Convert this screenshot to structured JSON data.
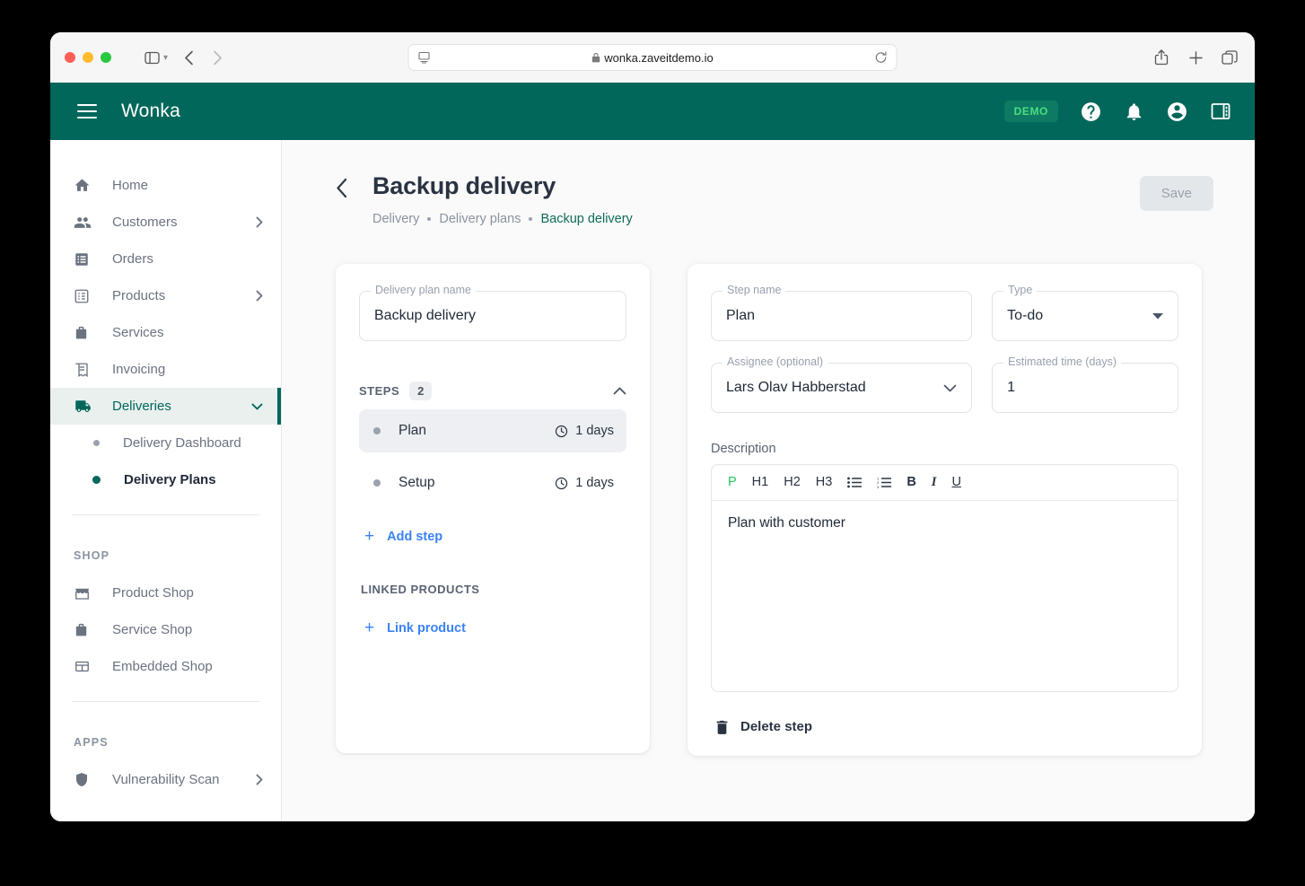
{
  "browser": {
    "url": "wonka.zaveitdemo.io",
    "icons": {
      "sidebar_toggle": "sidebar-toggle-icon",
      "back": "back-arrow-icon",
      "forward": "forward-arrow-icon",
      "reader": "reader-view-icon",
      "lock": "lock-icon",
      "reload": "reload-icon",
      "share": "share-icon",
      "new_tab": "plus-icon",
      "tabs": "tabs-overview-icon"
    }
  },
  "appbar": {
    "brand": "Wonka",
    "demo_badge": "DEMO",
    "menu_icon": "hamburger-menu-icon",
    "help_icon": "help-circle-icon",
    "bell_icon": "notification-bell-icon",
    "account_icon": "account-circle-icon",
    "panel_icon": "right-panel-icon",
    "bg_color": "#00675a",
    "badge_text_color": "#4ade80"
  },
  "sidebar": {
    "items": [
      {
        "label": "Home",
        "icon": "home-icon",
        "expandable": false,
        "active": false
      },
      {
        "label": "Customers",
        "icon": "people-icon",
        "expandable": true,
        "active": false
      },
      {
        "label": "Orders",
        "icon": "orders-icon",
        "expandable": false,
        "active": false
      },
      {
        "label": "Products",
        "icon": "products-grid-icon",
        "expandable": true,
        "active": false
      },
      {
        "label": "Services",
        "icon": "services-bag-icon",
        "expandable": false,
        "active": false
      },
      {
        "label": "Invoicing",
        "icon": "invoice-icon",
        "expandable": false,
        "active": false
      },
      {
        "label": "Deliveries",
        "icon": "truck-icon",
        "expandable": true,
        "active": true
      }
    ],
    "deliveries_children": [
      {
        "label": "Delivery Dashboard",
        "current": false
      },
      {
        "label": "Delivery Plans",
        "current": true
      }
    ],
    "shop_section": {
      "title": "SHOP",
      "items": [
        {
          "label": "Product Shop",
          "icon": "storefront-icon"
        },
        {
          "label": "Service Shop",
          "icon": "services-bag-icon"
        },
        {
          "label": "Embedded Shop",
          "icon": "embed-window-icon"
        }
      ]
    },
    "apps_section": {
      "title": "APPS",
      "items": [
        {
          "label": "Vulnerability Scan",
          "icon": "shield-icon",
          "expandable": true
        }
      ]
    }
  },
  "page": {
    "back_icon": "chevron-left-icon",
    "title": "Backup delivery",
    "breadcrumbs": [
      "Delivery",
      "Delivery plans",
      "Backup delivery"
    ],
    "save_label": "Save",
    "save_disabled": true
  },
  "plan_card": {
    "name_field": {
      "legend": "Delivery plan name",
      "value": "Backup delivery"
    },
    "steps_header": {
      "label": "STEPS",
      "count": "2",
      "collapse_icon": "chevron-up-icon"
    },
    "steps": [
      {
        "name": "Plan",
        "duration": "1 days",
        "selected": true,
        "clock_icon": "clock-icon"
      },
      {
        "name": "Setup",
        "duration": "1 days",
        "selected": false,
        "clock_icon": "clock-icon"
      }
    ],
    "add_step_label": "Add step",
    "linked_products_label": "LINKED PRODUCTS",
    "link_product_label": "Link product"
  },
  "step_card": {
    "step_name": {
      "legend": "Step name",
      "value": "Plan"
    },
    "type": {
      "legend": "Type",
      "value": "To-do",
      "caret_icon": "dropdown-triangle-icon"
    },
    "assignee": {
      "legend": "Assignee (optional)",
      "value": "Lars Olav Habberstad",
      "caret_icon": "chevron-down-icon"
    },
    "estimated_time": {
      "legend": "Estimated time (days)",
      "value": "1"
    },
    "description_label": "Description",
    "toolbar": [
      {
        "label": "P",
        "name": "paragraph-format-button",
        "active": true
      },
      {
        "label": "H1",
        "name": "heading1-button",
        "active": false
      },
      {
        "label": "H2",
        "name": "heading2-button",
        "active": false
      },
      {
        "label": "H3",
        "name": "heading3-button",
        "active": false
      },
      {
        "label": "",
        "name": "bulleted-list-icon",
        "active": false
      },
      {
        "label": "",
        "name": "numbered-list-icon",
        "active": false
      },
      {
        "label": "B",
        "name": "bold-button",
        "active": false
      },
      {
        "label": "I",
        "name": "italic-button",
        "active": false
      },
      {
        "label": "U",
        "name": "underline-button",
        "active": false
      }
    ],
    "description_text": "Plan with customer",
    "delete_label": "Delete step",
    "delete_icon": "trash-icon"
  }
}
